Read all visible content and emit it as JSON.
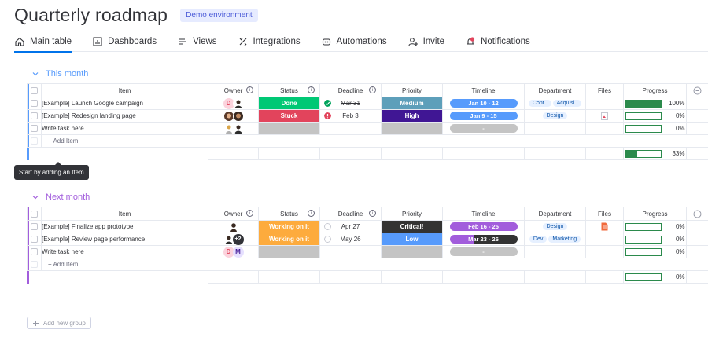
{
  "board": {
    "title": "Quarterly roadmap",
    "env_badge": "Demo environment"
  },
  "tabs": [
    {
      "label": "Main table",
      "icon": "home-icon"
    },
    {
      "label": "Dashboards",
      "icon": "dashboard-icon"
    },
    {
      "label": "Views",
      "icon": "views-icon"
    },
    {
      "label": "Integrations",
      "icon": "integrations-icon"
    },
    {
      "label": "Automations",
      "icon": "automations-icon"
    },
    {
      "label": "Invite",
      "icon": "invite-icon"
    },
    {
      "label": "Notifications",
      "icon": "notifications-icon"
    }
  ],
  "columns": {
    "item": "Item",
    "owner": "Owner",
    "status": "Status",
    "deadline": "Deadline",
    "priority": "Priority",
    "timeline": "Timeline",
    "department": "Department",
    "files": "Files",
    "progress": "Progress"
  },
  "colors": {
    "accent": "#0073ea",
    "group1": "#579bfc",
    "group2": "#a25ddc",
    "done": "#00c875",
    "stuck": "#e2445c",
    "working": "#fdab3d",
    "prio_medium": "#5d9fba",
    "prio_high": "#401694",
    "prio_critical": "#333333",
    "prio_low": "#579bfc",
    "empty": "#c4c4c4",
    "progress": "#2b8a4c"
  },
  "groups": [
    {
      "title": "This month",
      "rows": [
        {
          "item": "[Example] Launch Google campaign",
          "status": "Done",
          "deadline": "Mar 31",
          "deadline_state": "done",
          "priority": "Medium",
          "timeline": "Jan 10 - 12",
          "departments": [
            "Cont..",
            "Acquisi.."
          ],
          "file": false,
          "progress": "100%",
          "progress_value": 100
        },
        {
          "item": "[Example] Redesign landing page",
          "status": "Stuck",
          "deadline": "Feb 3",
          "deadline_state": "overdue",
          "priority": "High",
          "timeline": "Jan 9 - 15",
          "departments": [
            "Design"
          ],
          "file": true,
          "progress": "0%",
          "progress_value": 0
        },
        {
          "item": "Write task here",
          "status": "",
          "deadline": "",
          "deadline_state": "none",
          "priority": "",
          "timeline": "-",
          "departments": [],
          "file": false,
          "progress": "0%",
          "progress_value": 0
        }
      ],
      "add_item": "+ Add Item",
      "summary_progress": "33%",
      "summary_value": 33
    },
    {
      "title": "Next month",
      "rows": [
        {
          "item": "[Example] Finalize app prototype",
          "status": "Working on it",
          "deadline": "Apr 27",
          "deadline_state": "pending",
          "priority": "Critical!",
          "timeline": "Feb 16 - 25",
          "departments": [
            "Design"
          ],
          "file": true,
          "progress": "0%",
          "progress_value": 0
        },
        {
          "item": "[Example] Review page performance",
          "status": "Working on it",
          "deadline": "May 26",
          "deadline_state": "pending",
          "priority": "Low",
          "timeline": "Mar 23 - 26",
          "departments": [
            "Dev",
            "Marketing"
          ],
          "file": false,
          "progress": "0%",
          "progress_value": 0
        },
        {
          "item": "Write task here",
          "status": "",
          "deadline": "",
          "deadline_state": "none",
          "priority": "",
          "timeline": "-",
          "departments": [],
          "file": false,
          "progress": "0%",
          "progress_value": 0
        }
      ],
      "add_item": "+ Add Item",
      "summary_progress": "0%",
      "summary_value": 0
    }
  ],
  "tooltip": "Start by adding an Item",
  "add_group": "Add new group",
  "owner_initials": {
    "d": "D",
    "m": "M",
    "plus": "+2"
  }
}
